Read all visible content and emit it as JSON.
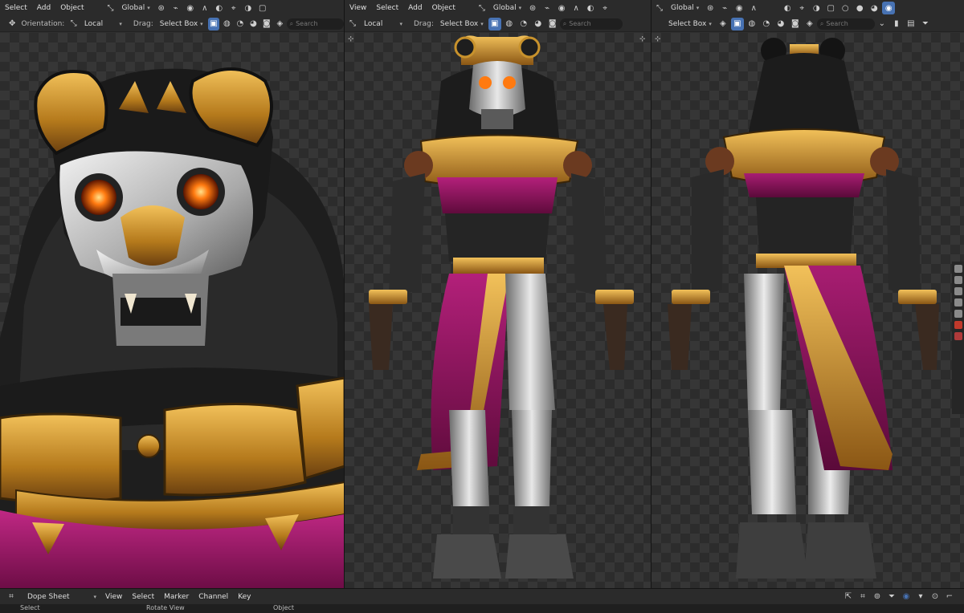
{
  "viewports": {
    "left": {
      "menus": [
        "Select",
        "Add",
        "Object"
      ],
      "transform_orientation": "Global",
      "orientation_label": "Orientation:",
      "orientation_value": "Local",
      "drag_label": "Drag:",
      "drag_value": "Select Box",
      "search_placeholder": "Search"
    },
    "middle": {
      "menus": [
        "View",
        "Select",
        "Add",
        "Object"
      ],
      "transform_orientation": "Global",
      "orientation_value": "Local",
      "drag_label": "Drag:",
      "drag_value": "Select Box",
      "search_placeholder": "Search"
    },
    "right": {
      "transform_orientation": "Global",
      "drag_value": "Select Box",
      "search_placeholder": "Search"
    }
  },
  "timeline": {
    "editor_type": "Dope Sheet",
    "menus": [
      "View",
      "Select",
      "Marker",
      "Channel",
      "Key"
    ]
  },
  "statusbar": {
    "select": "Select",
    "rotate_view": "Rotate View",
    "object": "Object"
  },
  "colors": {
    "accent": "#4772b3",
    "gold": "#c8922c",
    "magenta": "#a0176a",
    "eye_glow": "#ff7a10"
  },
  "icons": {
    "mode": "move-gizmo-icon",
    "shading_solid": "solid-shading-icon",
    "filter": "funnel-icon"
  }
}
